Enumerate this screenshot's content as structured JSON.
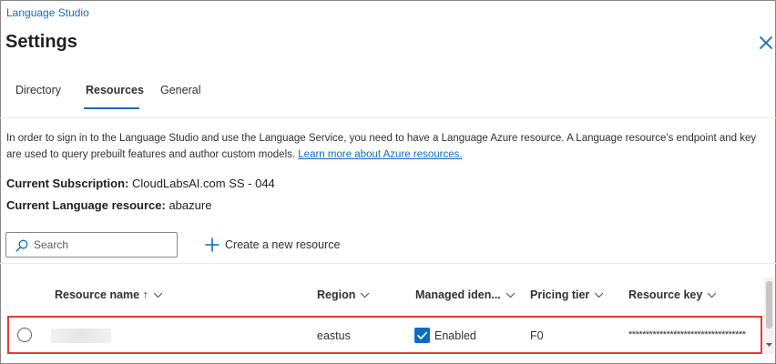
{
  "header": {
    "breadcrumb": "Language Studio",
    "title": "Settings",
    "close_icon": "close-icon"
  },
  "tabs": [
    {
      "label": "Directory",
      "selected": false
    },
    {
      "label": "Resources",
      "selected": true
    },
    {
      "label": "General",
      "selected": false
    }
  ],
  "description": {
    "text": "In order to sign in to the Language Studio and use the Language Service, you need to have a Language Azure resource. A Language resource's endpoint and key are used to query prebuilt features and author custom models.",
    "link_text": "Learn more about Azure resources."
  },
  "current": {
    "subscription_label": "Current Subscription:",
    "subscription_value": "CloudLabsAI.com SS - 044",
    "resource_label": "Current Language resource:",
    "resource_value": "abazure"
  },
  "toolbar": {
    "search_placeholder": "Search",
    "search_value": "",
    "create_label": "Create a new resource"
  },
  "table": {
    "columns": [
      {
        "label": "Resource name ↑",
        "sortable": true
      },
      {
        "label": "Region",
        "sortable": true
      },
      {
        "label": "Managed iden...",
        "sortable": true
      },
      {
        "label": "Pricing tier",
        "sortable": true
      },
      {
        "label": "Resource key",
        "sortable": true
      }
    ],
    "rows": [
      {
        "selected": false,
        "name": "",
        "region": "eastus",
        "managed_identity_checked": true,
        "managed_identity": "Enabled",
        "pricing_tier": "F0",
        "resource_key": "**********************************"
      }
    ]
  },
  "colors": {
    "accent": "#0f6cbd",
    "highlight_border": "#e23b3b",
    "text": "#201f1e"
  }
}
